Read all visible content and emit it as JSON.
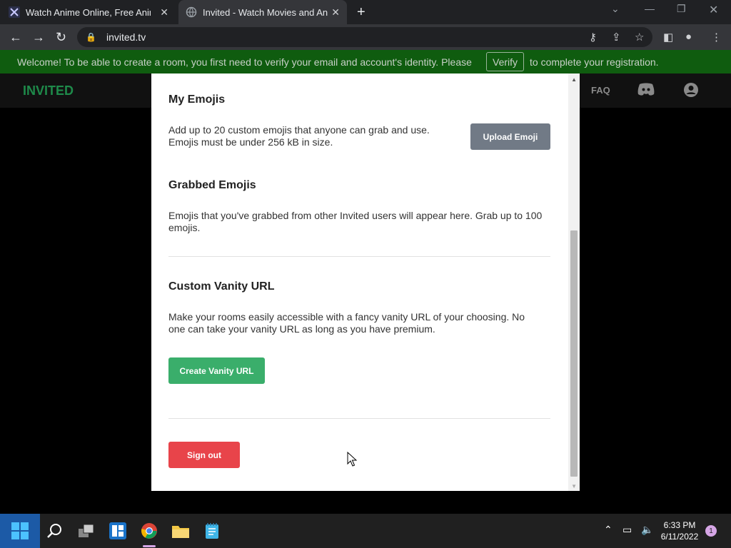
{
  "browser": {
    "tabs": [
      {
        "title": "Watch Anime Online, Free Anime"
      },
      {
        "title": "Invited - Watch Movies and Anime"
      }
    ],
    "new_tab_symbol": "+",
    "url": "invited.tv"
  },
  "banner": {
    "text_before": "Welcome! To be able to create a room, you first need to verify your email and account's identity. Please",
    "verify_label": "Verify",
    "text_after": "to complete your registration."
  },
  "site": {
    "logo": "INVITED",
    "faq": "FAQ"
  },
  "modal": {
    "my_emojis": {
      "heading": "My Emojis",
      "line1": "Add up to 20 custom emojis that anyone can grab and use.",
      "line2": "Emojis must be under 256 kB in size.",
      "upload_button": "Upload Emoji"
    },
    "grabbed_emojis": {
      "heading": "Grabbed Emojis",
      "line1": "Emojis that you've grabbed from other Invited users will appear here. Grab up to 100",
      "line2": "emojis."
    },
    "vanity": {
      "heading": "Custom Vanity URL",
      "line1": "Make your rooms easily accessible with a fancy vanity URL of your choosing. No",
      "line2": "one can take your vanity URL as long as you have premium.",
      "button": "Create Vanity URL"
    },
    "sign_out": "Sign out"
  },
  "taskbar": {
    "time": "6:33 PM",
    "date": "6/11/2022",
    "notifications": "1"
  },
  "colors": {
    "green_button": "#3aae6b",
    "grey_button": "#717a86",
    "red_button": "#e8444a",
    "banner_bg": "#0f5c0f",
    "logo": "#1e8a4a"
  }
}
